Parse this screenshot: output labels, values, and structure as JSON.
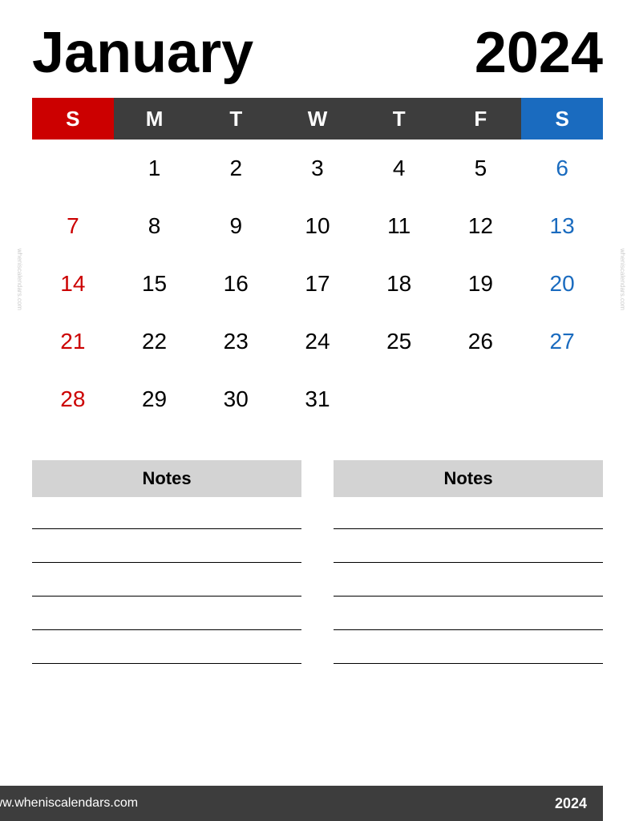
{
  "header": {
    "month": "January",
    "year": "2024"
  },
  "calendar": {
    "days_header": [
      {
        "label": "S",
        "type": "sunday"
      },
      {
        "label": "M",
        "type": "weekday"
      },
      {
        "label": "T",
        "type": "weekday"
      },
      {
        "label": "W",
        "type": "weekday"
      },
      {
        "label": "T",
        "type": "weekday"
      },
      {
        "label": "F",
        "type": "weekday"
      },
      {
        "label": "S",
        "type": "saturday"
      }
    ],
    "weeks": [
      [
        {
          "day": "",
          "type": "empty"
        },
        {
          "day": "1",
          "type": "weekday"
        },
        {
          "day": "2",
          "type": "weekday"
        },
        {
          "day": "3",
          "type": "weekday"
        },
        {
          "day": "4",
          "type": "weekday"
        },
        {
          "day": "5",
          "type": "weekday"
        },
        {
          "day": "6",
          "type": "saturday"
        }
      ],
      [
        {
          "day": "7",
          "type": "sunday"
        },
        {
          "day": "8",
          "type": "weekday"
        },
        {
          "day": "9",
          "type": "weekday"
        },
        {
          "day": "10",
          "type": "weekday"
        },
        {
          "day": "11",
          "type": "weekday"
        },
        {
          "day": "12",
          "type": "weekday"
        },
        {
          "day": "13",
          "type": "saturday"
        }
      ],
      [
        {
          "day": "14",
          "type": "sunday"
        },
        {
          "day": "15",
          "type": "weekday"
        },
        {
          "day": "16",
          "type": "weekday"
        },
        {
          "day": "17",
          "type": "weekday"
        },
        {
          "day": "18",
          "type": "weekday"
        },
        {
          "day": "19",
          "type": "weekday"
        },
        {
          "day": "20",
          "type": "saturday"
        }
      ],
      [
        {
          "day": "21",
          "type": "sunday"
        },
        {
          "day": "22",
          "type": "weekday"
        },
        {
          "day": "23",
          "type": "weekday"
        },
        {
          "day": "24",
          "type": "weekday"
        },
        {
          "day": "25",
          "type": "weekday"
        },
        {
          "day": "26",
          "type": "weekday"
        },
        {
          "day": "27",
          "type": "saturday"
        }
      ],
      [
        {
          "day": "28",
          "type": "sunday"
        },
        {
          "day": "29",
          "type": "weekday"
        },
        {
          "day": "30",
          "type": "weekday"
        },
        {
          "day": "31",
          "type": "weekday"
        },
        {
          "day": "",
          "type": "empty"
        },
        {
          "day": "",
          "type": "empty"
        },
        {
          "day": "",
          "type": "empty"
        }
      ]
    ]
  },
  "notes": [
    {
      "label": "Notes"
    },
    {
      "label": "Notes"
    }
  ],
  "footer": {
    "url": "www.wheniscalendars.com",
    "year": "2024"
  },
  "watermark": "wheniscalendars.com"
}
